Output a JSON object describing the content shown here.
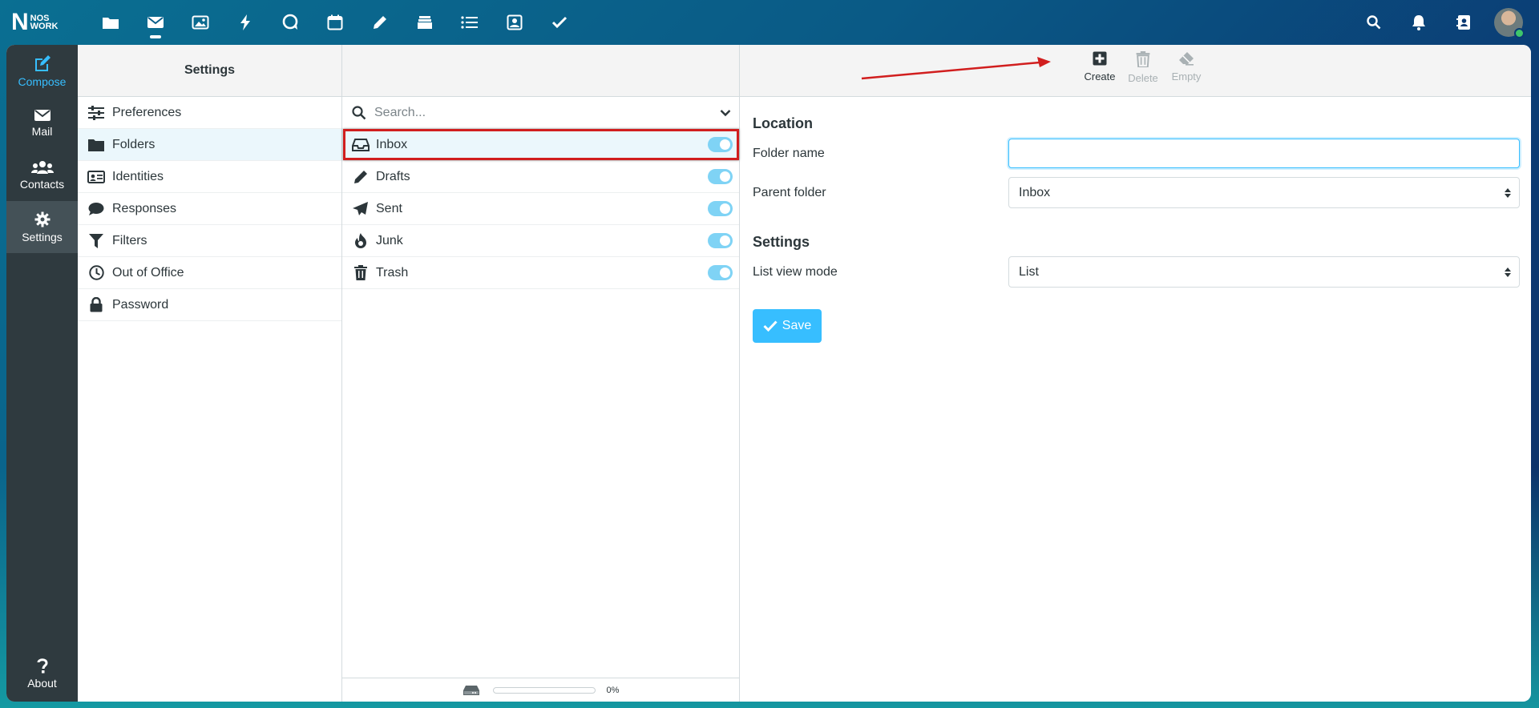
{
  "brand": {
    "logo_letter": "N",
    "logo_line1": "NOS",
    "logo_line2": "WORK"
  },
  "top_nav": [
    "files",
    "mail",
    "photos",
    "activity",
    "chat",
    "calendar",
    "notes",
    "deck",
    "tasks",
    "contacts",
    "todo"
  ],
  "rail": {
    "compose": "Compose",
    "mail": "Mail",
    "contacts": "Contacts",
    "settings": "Settings",
    "about": "About"
  },
  "settings_column": {
    "title": "Settings",
    "items": [
      {
        "label": "Preferences",
        "icon": "sliders-icon"
      },
      {
        "label": "Folders",
        "icon": "folder-icon"
      },
      {
        "label": "Identities",
        "icon": "id-card-icon"
      },
      {
        "label": "Responses",
        "icon": "comment-icon"
      },
      {
        "label": "Filters",
        "icon": "filter-icon"
      },
      {
        "label": "Out of Office",
        "icon": "clock-icon"
      },
      {
        "label": "Password",
        "icon": "lock-icon"
      }
    ],
    "selected": "Folders"
  },
  "folders_column": {
    "search_placeholder": "Search...",
    "folders": [
      {
        "name": "Inbox",
        "subscribed": true
      },
      {
        "name": "Drafts",
        "subscribed": true
      },
      {
        "name": "Sent",
        "subscribed": true
      },
      {
        "name": "Junk",
        "subscribed": true
      },
      {
        "name": "Trash",
        "subscribed": true
      }
    ],
    "selected": "Inbox",
    "quota": {
      "text": "0%",
      "fraction": 0.0
    }
  },
  "toolbar": {
    "create": "Create",
    "delete": "Delete",
    "empty": "Empty"
  },
  "form": {
    "location_title": "Location",
    "folder_name_label": "Folder name",
    "folder_name_value": "",
    "parent_folder_label": "Parent folder",
    "parent_folder_value": "Inbox",
    "settings_title": "Settings",
    "list_view_label": "List view mode",
    "list_view_value": "List",
    "save": "Save"
  },
  "colors": {
    "accent": "#37beff",
    "highlight": "#d11e1e",
    "rail": "#2f3a3f"
  }
}
